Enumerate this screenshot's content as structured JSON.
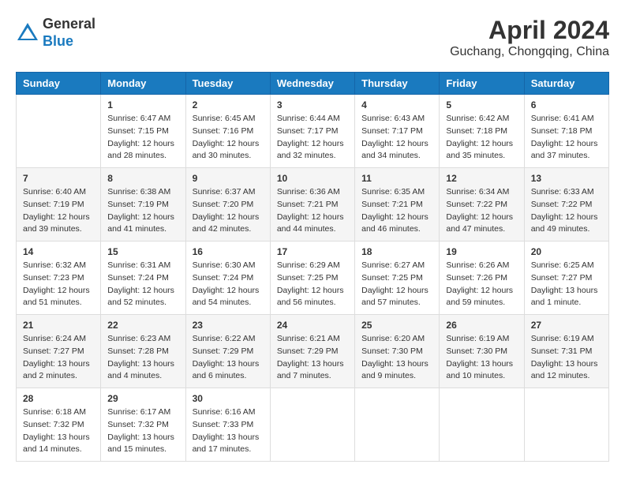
{
  "header": {
    "logo_general": "General",
    "logo_blue": "Blue",
    "month_year": "April 2024",
    "location": "Guchang, Chongqing, China"
  },
  "calendar": {
    "days_of_week": [
      "Sunday",
      "Monday",
      "Tuesday",
      "Wednesday",
      "Thursday",
      "Friday",
      "Saturday"
    ],
    "weeks": [
      [
        {
          "day": "",
          "info": ""
        },
        {
          "day": "1",
          "info": "Sunrise: 6:47 AM\nSunset: 7:15 PM\nDaylight: 12 hours\nand 28 minutes."
        },
        {
          "day": "2",
          "info": "Sunrise: 6:45 AM\nSunset: 7:16 PM\nDaylight: 12 hours\nand 30 minutes."
        },
        {
          "day": "3",
          "info": "Sunrise: 6:44 AM\nSunset: 7:17 PM\nDaylight: 12 hours\nand 32 minutes."
        },
        {
          "day": "4",
          "info": "Sunrise: 6:43 AM\nSunset: 7:17 PM\nDaylight: 12 hours\nand 34 minutes."
        },
        {
          "day": "5",
          "info": "Sunrise: 6:42 AM\nSunset: 7:18 PM\nDaylight: 12 hours\nand 35 minutes."
        },
        {
          "day": "6",
          "info": "Sunrise: 6:41 AM\nSunset: 7:18 PM\nDaylight: 12 hours\nand 37 minutes."
        }
      ],
      [
        {
          "day": "7",
          "info": "Sunrise: 6:40 AM\nSunset: 7:19 PM\nDaylight: 12 hours\nand 39 minutes."
        },
        {
          "day": "8",
          "info": "Sunrise: 6:38 AM\nSunset: 7:19 PM\nDaylight: 12 hours\nand 41 minutes."
        },
        {
          "day": "9",
          "info": "Sunrise: 6:37 AM\nSunset: 7:20 PM\nDaylight: 12 hours\nand 42 minutes."
        },
        {
          "day": "10",
          "info": "Sunrise: 6:36 AM\nSunset: 7:21 PM\nDaylight: 12 hours\nand 44 minutes."
        },
        {
          "day": "11",
          "info": "Sunrise: 6:35 AM\nSunset: 7:21 PM\nDaylight: 12 hours\nand 46 minutes."
        },
        {
          "day": "12",
          "info": "Sunrise: 6:34 AM\nSunset: 7:22 PM\nDaylight: 12 hours\nand 47 minutes."
        },
        {
          "day": "13",
          "info": "Sunrise: 6:33 AM\nSunset: 7:22 PM\nDaylight: 12 hours\nand 49 minutes."
        }
      ],
      [
        {
          "day": "14",
          "info": "Sunrise: 6:32 AM\nSunset: 7:23 PM\nDaylight: 12 hours\nand 51 minutes."
        },
        {
          "day": "15",
          "info": "Sunrise: 6:31 AM\nSunset: 7:24 PM\nDaylight: 12 hours\nand 52 minutes."
        },
        {
          "day": "16",
          "info": "Sunrise: 6:30 AM\nSunset: 7:24 PM\nDaylight: 12 hours\nand 54 minutes."
        },
        {
          "day": "17",
          "info": "Sunrise: 6:29 AM\nSunset: 7:25 PM\nDaylight: 12 hours\nand 56 minutes."
        },
        {
          "day": "18",
          "info": "Sunrise: 6:27 AM\nSunset: 7:25 PM\nDaylight: 12 hours\nand 57 minutes."
        },
        {
          "day": "19",
          "info": "Sunrise: 6:26 AM\nSunset: 7:26 PM\nDaylight: 12 hours\nand 59 minutes."
        },
        {
          "day": "20",
          "info": "Sunrise: 6:25 AM\nSunset: 7:27 PM\nDaylight: 13 hours\nand 1 minute."
        }
      ],
      [
        {
          "day": "21",
          "info": "Sunrise: 6:24 AM\nSunset: 7:27 PM\nDaylight: 13 hours\nand 2 minutes."
        },
        {
          "day": "22",
          "info": "Sunrise: 6:23 AM\nSunset: 7:28 PM\nDaylight: 13 hours\nand 4 minutes."
        },
        {
          "day": "23",
          "info": "Sunrise: 6:22 AM\nSunset: 7:29 PM\nDaylight: 13 hours\nand 6 minutes."
        },
        {
          "day": "24",
          "info": "Sunrise: 6:21 AM\nSunset: 7:29 PM\nDaylight: 13 hours\nand 7 minutes."
        },
        {
          "day": "25",
          "info": "Sunrise: 6:20 AM\nSunset: 7:30 PM\nDaylight: 13 hours\nand 9 minutes."
        },
        {
          "day": "26",
          "info": "Sunrise: 6:19 AM\nSunset: 7:30 PM\nDaylight: 13 hours\nand 10 minutes."
        },
        {
          "day": "27",
          "info": "Sunrise: 6:19 AM\nSunset: 7:31 PM\nDaylight: 13 hours\nand 12 minutes."
        }
      ],
      [
        {
          "day": "28",
          "info": "Sunrise: 6:18 AM\nSunset: 7:32 PM\nDaylight: 13 hours\nand 14 minutes."
        },
        {
          "day": "29",
          "info": "Sunrise: 6:17 AM\nSunset: 7:32 PM\nDaylight: 13 hours\nand 15 minutes."
        },
        {
          "day": "30",
          "info": "Sunrise: 6:16 AM\nSunset: 7:33 PM\nDaylight: 13 hours\nand 17 minutes."
        },
        {
          "day": "",
          "info": ""
        },
        {
          "day": "",
          "info": ""
        },
        {
          "day": "",
          "info": ""
        },
        {
          "day": "",
          "info": ""
        }
      ]
    ]
  }
}
